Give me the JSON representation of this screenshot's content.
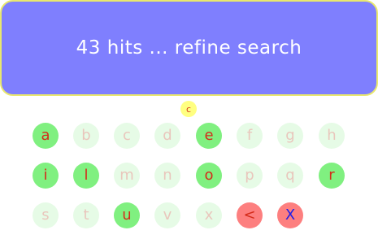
{
  "status": {
    "message": "43 hits ... refine search"
  },
  "query": {
    "letter": "c"
  },
  "keyboard": {
    "keys": [
      {
        "label": "a",
        "state": "active"
      },
      {
        "label": "b",
        "state": "disabled"
      },
      {
        "label": "c",
        "state": "disabled"
      },
      {
        "label": "d",
        "state": "disabled"
      },
      {
        "label": "e",
        "state": "active"
      },
      {
        "label": "f",
        "state": "disabled"
      },
      {
        "label": "g",
        "state": "disabled"
      },
      {
        "label": "h",
        "state": "disabled"
      },
      {
        "label": "i",
        "state": "active"
      },
      {
        "label": "l",
        "state": "active"
      },
      {
        "label": "m",
        "state": "disabled"
      },
      {
        "label": "n",
        "state": "disabled"
      },
      {
        "label": "o",
        "state": "active"
      },
      {
        "label": "p",
        "state": "disabled"
      },
      {
        "label": "q",
        "state": "disabled"
      },
      {
        "label": "r",
        "state": "active"
      },
      {
        "label": "s",
        "state": "disabled"
      },
      {
        "label": "t",
        "state": "disabled"
      },
      {
        "label": "u",
        "state": "active"
      },
      {
        "label": "v",
        "state": "disabled"
      },
      {
        "label": "x",
        "state": "disabled"
      },
      {
        "label": "<",
        "state": "action"
      },
      {
        "label": "X",
        "state": "clear"
      }
    ]
  },
  "colors": {
    "banner": "#7f7ffe",
    "banner_border": "#e9e86e",
    "active_key": "#80f080",
    "disabled_key": "#e6fbe6",
    "action_key": "#fd7f7f",
    "query_chip": "#ffff80"
  }
}
